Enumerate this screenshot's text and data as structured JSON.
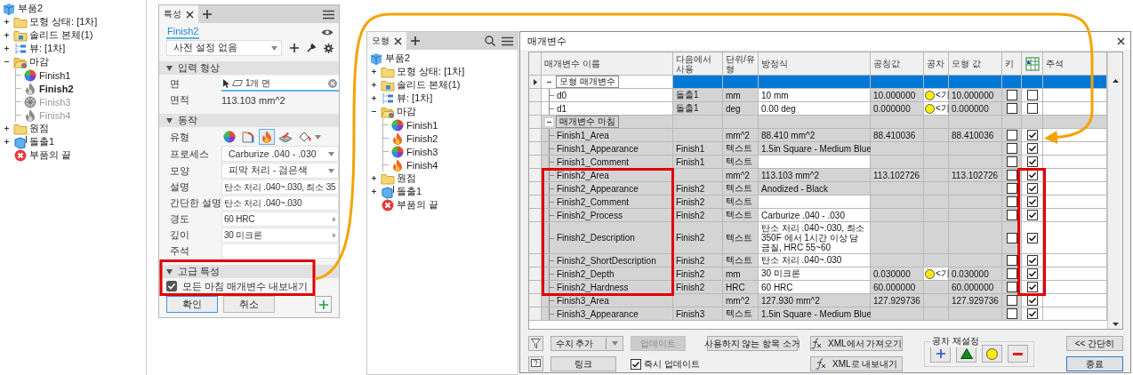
{
  "left_browser": {
    "tree": [
      {
        "label": "부품2",
        "kind": "part",
        "children": [
          {
            "label": "모형 상태: [1차]",
            "kind": "folder",
            "expanded": false
          },
          {
            "label": "솔리드 본체(1)",
            "kind": "solid-folder",
            "expanded": false
          },
          {
            "label": "뷰: [1차]",
            "kind": "view",
            "expanded": false
          },
          {
            "label": "마감",
            "kind": "finish-folder",
            "expanded": true,
            "children": [
              {
                "label": "Finish1",
                "kind": "appearance",
                "active": false,
                "suppressed": false
              },
              {
                "label": "Finish2",
                "kind": "fire-outline",
                "active": true,
                "suppressed": false
              },
              {
                "label": "Finish3",
                "kind": "wheel",
                "active": false,
                "suppressed": true
              },
              {
                "label": "Finish4",
                "kind": "fire-outline",
                "active": false,
                "suppressed": true
              }
            ]
          },
          {
            "label": "원점",
            "kind": "folder",
            "expanded": false
          },
          {
            "label": "돌출1",
            "kind": "extrude",
            "expanded": false
          },
          {
            "label": "부품의 끝",
            "kind": "end"
          }
        ]
      }
    ]
  },
  "properties_panel": {
    "tabs": [
      {
        "label": "특성",
        "selected": true
      }
    ],
    "feature": "Finish2",
    "preset": "사전 설정 없음",
    "sections": [
      {
        "title": "입력 형상",
        "expanded": true,
        "rows": [
          {
            "kind": "selector",
            "label": "면",
            "value": "1개 면"
          },
          {
            "kind": "readout",
            "label": "면적",
            "value": "113.103 mm^2"
          }
        ]
      },
      {
        "title": "동작",
        "expanded": true,
        "rows": [
          {
            "kind": "icons",
            "label": "유형",
            "options": [
              {
                "kind": "appearance",
                "selected": false
              },
              {
                "kind": "paint",
                "selected": false
              },
              {
                "kind": "fire",
                "selected": true
              },
              {
                "kind": "decal",
                "selected": false
              },
              {
                "kind": "bucket",
                "selected": false
              }
            ]
          },
          {
            "kind": "dropdown",
            "label": "프로세스",
            "value": "Carburize .040 - .030"
          },
          {
            "kind": "dropdown",
            "label": "모양",
            "value": "피막 처리 - 검은색"
          },
          {
            "kind": "field",
            "label": "설명",
            "value": "탄소 처리 .040~.030, 최소 35"
          },
          {
            "kind": "field",
            "label": "간단한 설명",
            "value": "탄소 처리 .040~.030"
          },
          {
            "kind": "stepper",
            "label": "경도",
            "value": "60 HRC"
          },
          {
            "kind": "stepper",
            "label": "깊이",
            "value": "30 미크론"
          },
          {
            "kind": "field",
            "label": "주석"
          }
        ]
      },
      {
        "title": "고급 특성",
        "expanded": true,
        "rows": [
          {
            "kind": "checkbox",
            "label": "모든 마침 매개변수 내보내기",
            "checked": true
          }
        ]
      }
    ],
    "buttons": [
      "확인",
      "취소"
    ]
  },
  "model_browser": {
    "tabs": [
      {
        "label": "모형",
        "selected": true
      }
    ],
    "tree": [
      {
        "label": "부품2",
        "kind": "part",
        "children": [
          {
            "label": "모형 상태: [1차]",
            "kind": "folder",
            "expanded": false
          },
          {
            "label": "솔리드 본체(1)",
            "kind": "solid-folder",
            "expanded": false
          },
          {
            "label": "뷰: [1차]",
            "kind": "view",
            "expanded": false
          },
          {
            "label": "마감",
            "kind": "finish-folder",
            "expanded": true,
            "children": [
              {
                "label": "Finish1",
                "kind": "appearance"
              },
              {
                "label": "Finish2",
                "kind": "fire"
              },
              {
                "label": "Finish3",
                "kind": "appearance"
              },
              {
                "label": "Finish4",
                "kind": "fire"
              }
            ]
          },
          {
            "label": "원점",
            "kind": "folder",
            "expanded": false
          },
          {
            "label": "돌출1",
            "kind": "extrude",
            "expanded": false
          },
          {
            "label": "부품의 끝",
            "kind": "end"
          }
        ]
      }
    ]
  },
  "parameters_dialog": {
    "title": "매개변수",
    "columns": [
      "매개변수 이름",
      "다음에서 사용",
      "단위/유형",
      "방정식",
      "공칭값",
      "공차",
      "모형 값",
      "키",
      "주석"
    ],
    "groups": [
      {
        "name": "모형 매개변수",
        "kind": "model",
        "expanded": true,
        "selected": true,
        "parameters": [
          {
            "name": "d0",
            "used_by": "돌출1",
            "unit": "mm",
            "equation": "10 mm",
            "editable": true,
            "nominal": "10.000000",
            "tolerance": "<기",
            "model_value": "10.000000",
            "key": false,
            "export": false
          },
          {
            "name": "d1",
            "used_by": "돌출1",
            "unit": "deg",
            "equation": "0.00 deg",
            "editable": true,
            "nominal": "0.000000",
            "tolerance": "<기",
            "model_value": "0.000000",
            "key": false,
            "export": false
          }
        ]
      },
      {
        "name": "매개변수 마침",
        "kind": "finish",
        "expanded": true,
        "selected": false,
        "parameters": [
          {
            "name": "Finish1_Area",
            "unit": "mm^2",
            "equation": "88.410 mm^2",
            "editable": false,
            "nominal": "88.410036",
            "model_value": "88.410036",
            "key": false,
            "export": true
          },
          {
            "name": "Finish1_Appearance",
            "used_by": "Finish1",
            "unit": "텍스트",
            "equation": "1.5in Square - Medium Blue",
            "editable": false,
            "key": false,
            "export": true
          },
          {
            "name": "Finish1_Comment",
            "used_by": "Finish1",
            "unit": "텍스트",
            "editable": true,
            "key": false,
            "export": true
          },
          {
            "name": "Finish2_Area",
            "unit": "mm^2",
            "equation": "113.103 mm^2",
            "editable": false,
            "nominal": "113.102726",
            "model_value": "113.102726",
            "key": false,
            "export": true
          },
          {
            "name": "Finish2_Appearance",
            "used_by": "Finish2",
            "unit": "텍스트",
            "equation": "Anodized - Black",
            "editable": false,
            "key": false,
            "export": true
          },
          {
            "name": "Finish2_Comment",
            "used_by": "Finish2",
            "unit": "텍스트",
            "editable": true,
            "key": false,
            "export": true
          },
          {
            "name": "Finish2_Process",
            "used_by": "Finish2",
            "unit": "텍스트",
            "equation": "Carburize .040 - .030",
            "editable": true,
            "key": false,
            "export": true
          },
          {
            "name": "Finish2_Description",
            "used_by": "Finish2",
            "unit": "텍스트",
            "equation": "탄소 처리 .040~.030, 최소 350F 에서 1시간 이상 담금질, HRC 55~60",
            "editable": true,
            "key": false,
            "export": true
          },
          {
            "name": "Finish2_ShortDescription",
            "used_by": "Finish2",
            "unit": "텍스트",
            "equation": "탄소 처리 .040~.030",
            "editable": true,
            "key": false,
            "export": true
          },
          {
            "name": "Finish2_Depth",
            "used_by": "Finish2",
            "unit": "mm",
            "equation": "30 미크론",
            "editable": true,
            "nominal": "0.030000",
            "tolerance": "<기",
            "model_value": "0.030000",
            "key": false,
            "export": true
          },
          {
            "name": "Finish2_Hardness",
            "used_by": "Finish2",
            "unit": "HRC",
            "equation": "60 HRC",
            "editable": true,
            "nominal": "60.000000",
            "model_value": "60.000000",
            "key": false,
            "export": true
          },
          {
            "name": "Finish3_Area",
            "unit": "mm^2",
            "equation": "127.930 mm^2",
            "editable": false,
            "nominal": "127.929736",
            "model_value": "127.929736",
            "key": false,
            "export": true
          },
          {
            "name": "Finish3_Appearance",
            "used_by": "Finish3",
            "unit": "텍스트",
            "equation": "1.5in Square - Medium Blue",
            "editable": false,
            "key": false,
            "export": true
          }
        ]
      }
    ],
    "toolbar": {
      "add_numeric": "수치 추가",
      "update": {
        "label": "업데이트",
        "disabled": true
      },
      "purge": "사용하지 않는 항목 소거",
      "import_xml": "XML에서 가져오기",
      "link": "링크",
      "immediate_update": {
        "label": "즉시 업데이트",
        "checked": true
      },
      "export_xml": "XML로 내보내기",
      "tolerance_reset": "공차 재설정",
      "less": "<< 간단히",
      "done": "종료"
    }
  }
}
